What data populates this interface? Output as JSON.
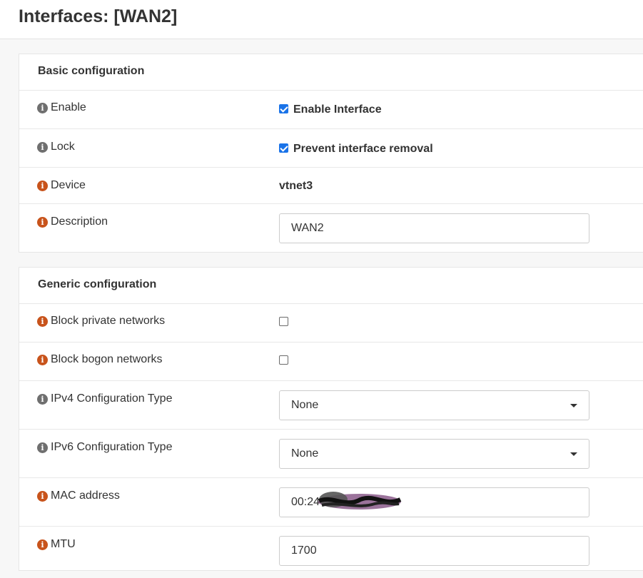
{
  "page": {
    "title": "Interfaces: [WAN2]"
  },
  "basic": {
    "title": "Basic configuration",
    "enable": {
      "label": "Enable",
      "checkbox_label": "Enable Interface",
      "checked": true
    },
    "lock": {
      "label": "Lock",
      "checkbox_label": "Prevent interface removal",
      "checked": true
    },
    "device": {
      "label": "Device",
      "value": "vtnet3"
    },
    "description": {
      "label": "Description",
      "value": "WAN2"
    }
  },
  "generic": {
    "title": "Generic configuration",
    "block_private": {
      "label": "Block private networks",
      "checked": false
    },
    "block_bogon": {
      "label": "Block bogon networks",
      "checked": false
    },
    "ipv4_type": {
      "label": "IPv4 Configuration Type",
      "value": "None"
    },
    "ipv6_type": {
      "label": "IPv6 Configuration Type",
      "value": "None"
    },
    "mac": {
      "label": "MAC address",
      "value": "00:24"
    },
    "mtu": {
      "label": "MTU",
      "value": "1700"
    }
  },
  "colors": {
    "checkbox_accent": "#1a73e8",
    "info_gray": "#6f6f6f",
    "info_orange": "#c8531b"
  }
}
